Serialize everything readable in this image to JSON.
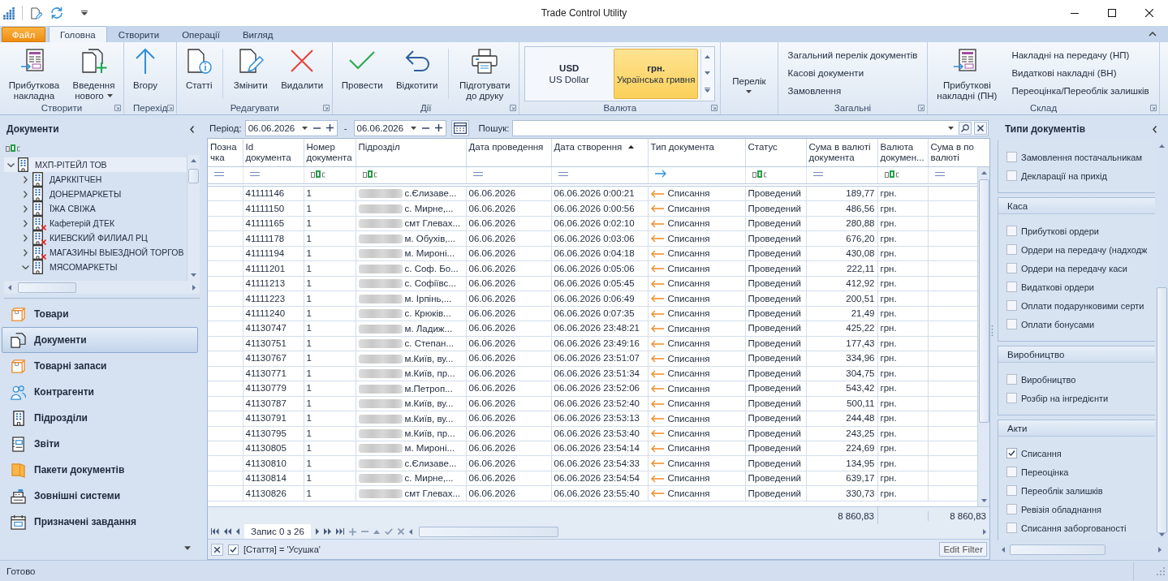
{
  "window": {
    "title": "Trade Control Utility"
  },
  "ribbon": {
    "file_tab": "Файл",
    "tabs": [
      {
        "label": "Головна",
        "selected": true
      },
      {
        "label": "Створити",
        "selected": false
      },
      {
        "label": "Операції",
        "selected": false
      },
      {
        "label": "Вигляд",
        "selected": false
      }
    ],
    "groups": [
      {
        "title": "Створити",
        "launcher": true,
        "items": [
          {
            "kind": "large",
            "label": "Прибуткова накладна",
            "dropdown": false
          },
          {
            "kind": "large",
            "label": "Введення нового",
            "dropdown": true
          }
        ]
      },
      {
        "title": "Перехід",
        "launcher": true,
        "items": [
          {
            "kind": "large",
            "label": "Вгору",
            "dropdown": false
          }
        ]
      },
      {
        "title": "Редагувати",
        "launcher": true,
        "items": [
          {
            "kind": "large",
            "label": "Статті",
            "dropdown": false
          },
          {
            "kind": "separator"
          },
          {
            "kind": "large",
            "label": "Змінити",
            "dropdown": false
          },
          {
            "kind": "large",
            "label": "Видалити",
            "dropdown": false
          }
        ]
      },
      {
        "title": "Дії",
        "launcher": true,
        "items": [
          {
            "kind": "large",
            "label": "Провести",
            "dropdown": false
          },
          {
            "kind": "large",
            "label": "Відкотити",
            "dropdown": false
          },
          {
            "kind": "separator"
          },
          {
            "kind": "large",
            "label": "Підготувати до друку",
            "dropdown": false
          }
        ]
      },
      {
        "title": "Валюта",
        "launcher": true,
        "items": [
          {
            "kind": "gallery",
            "options": [
              {
                "code": "USD",
                "name": "US Dollar",
                "selected": false
              },
              {
                "code": "грн.",
                "name": "Українська гривня",
                "selected": true
              }
            ]
          }
        ]
      },
      {
        "items": [
          {
            "kind": "dropdown",
            "label": "Перелік"
          }
        ]
      },
      {
        "title": "Загальні",
        "launcher": true,
        "items": [
          {
            "kind": "links",
            "entries": [
              "Загальний перелік документів",
              "Касові документи",
              "Замовлення"
            ]
          }
        ]
      },
      {
        "title": "Склад",
        "launcher": true,
        "items": [
          {
            "kind": "large",
            "label": "Прибуткові накладні (ПН)",
            "dropdown": false
          },
          {
            "kind": "links",
            "entries": [
              "Накладні на передачу (НП)",
              "Видаткові накладні (ВН)",
              "Переоцінка/Переоблік залишків"
            ]
          }
        ]
      }
    ]
  },
  "left_panel": {
    "title": "Документи",
    "tree": [
      {
        "label": "МХП-РІТЕЙЛ ТОВ",
        "expanded": true,
        "selected": true,
        "inactive": false,
        "children": [
          {
            "label": "ДАРККІТЧЕН",
            "expanded": false,
            "selected": false,
            "inactive": false
          },
          {
            "label": "ДОНЕРМАРКЕТЫ",
            "expanded": false,
            "selected": false,
            "inactive": false
          },
          {
            "label": "ЇЖА СВІЖА",
            "expanded": false,
            "selected": false,
            "inactive": false
          },
          {
            "label": "Кафетерій ДТЕК",
            "expanded": false,
            "selected": false,
            "inactive": true
          },
          {
            "label": "КИЕВСКИЙ ФИЛИАЛ РЦ",
            "expanded": false,
            "selected": false,
            "inactive": true
          },
          {
            "label": "МАГАЗИНЫ ВЫЕЗДНОЙ ТОРГОВ",
            "expanded": false,
            "selected": false,
            "inactive": true
          },
          {
            "label": "МЯСОМАРКЕТЫ",
            "expanded": true,
            "selected": false,
            "inactive": false
          }
        ]
      }
    ],
    "nav": [
      {
        "label": "Товари",
        "selected": false
      },
      {
        "label": "Документи",
        "selected": true
      },
      {
        "label": "Товарні запаси",
        "selected": false
      },
      {
        "label": "Контрагенти",
        "selected": false
      },
      {
        "label": "Підрозділи",
        "selected": false
      },
      {
        "label": "Звіти",
        "selected": false
      },
      {
        "label": "Пакети документів",
        "selected": false
      },
      {
        "label": "Зовнішні системи",
        "selected": false
      },
      {
        "label": "Призначені завдання",
        "selected": false
      }
    ]
  },
  "period": {
    "label": "Період:",
    "from": "06.06.2026",
    "separator": "-",
    "to": "06.06.2026"
  },
  "search": {
    "label": "Пошук:"
  },
  "table": {
    "columns": [
      {
        "label": "Позначка",
        "kind": "equals",
        "sorted": false
      },
      {
        "label": "Id документа",
        "kind": "equals",
        "sorted": false
      },
      {
        "label": "Номер документа",
        "kind": "text",
        "sorted": false
      },
      {
        "label": "Підрозділ",
        "kind": "text",
        "sorted": false
      },
      {
        "label": "Дата проведення",
        "kind": "equals",
        "sorted": false
      },
      {
        "label": "Дата створення",
        "kind": "equals",
        "sorted": true
      },
      {
        "label": "Тип документа",
        "kind": "arrow",
        "sorted": false
      },
      {
        "label": "Статус",
        "kind": "text",
        "sorted": false
      },
      {
        "label": "Сума в валюті документа",
        "kind": "equals",
        "sorted": false
      },
      {
        "label": "Валюта докумен...",
        "kind": "text",
        "sorted": false
      },
      {
        "label": "Сума в по валюті",
        "kind": "equals",
        "sorted": false
      }
    ],
    "rows": [
      {
        "id": "41111146",
        "number": "1",
        "subdivision": "с.Єлизаве...",
        "posted": "06.06.2026",
        "created": "06.06.2026 0:00:21",
        "type": "Списання",
        "status": "Проведений",
        "amount": "189,77",
        "currency": "грн."
      },
      {
        "id": "41111150",
        "number": "1",
        "subdivision": "с. Мирне,...",
        "posted": "06.06.2026",
        "created": "06.06.2026 0:00:56",
        "type": "Списання",
        "status": "Проведений",
        "amount": "486,56",
        "currency": "грн."
      },
      {
        "id": "41111165",
        "number": "1",
        "subdivision": "смт Глевах...",
        "posted": "06.06.2026",
        "created": "06.06.2026 0:02:10",
        "type": "Списання",
        "status": "Проведений",
        "amount": "280,88",
        "currency": "грн."
      },
      {
        "id": "41111178",
        "number": "1",
        "subdivision": "м. Обухів,...",
        "posted": "06.06.2026",
        "created": "06.06.2026 0:03:06",
        "type": "Списання",
        "status": "Проведений",
        "amount": "676,20",
        "currency": "грн."
      },
      {
        "id": "41111194",
        "number": "1",
        "subdivision": "м. Миронi...",
        "posted": "06.06.2026",
        "created": "06.06.2026 0:04:18",
        "type": "Списання",
        "status": "Проведений",
        "amount": "430,08",
        "currency": "грн."
      },
      {
        "id": "41111201",
        "number": "1",
        "subdivision": "с. Соф. Бо...",
        "posted": "06.06.2026",
        "created": "06.06.2026 0:05:06",
        "type": "Списання",
        "status": "Проведений",
        "amount": "222,11",
        "currency": "грн."
      },
      {
        "id": "41111213",
        "number": "1",
        "subdivision": "с. Софіївс...",
        "posted": "06.06.2026",
        "created": "06.06.2026 0:05:45",
        "type": "Списання",
        "status": "Проведений",
        "amount": "412,92",
        "currency": "грн."
      },
      {
        "id": "41111223",
        "number": "1",
        "subdivision": "м. Ірпінь,...",
        "posted": "06.06.2026",
        "created": "06.06.2026 0:06:49",
        "type": "Списання",
        "status": "Проведений",
        "amount": "200,51",
        "currency": "грн."
      },
      {
        "id": "41111240",
        "number": "1",
        "subdivision": "с. Крюків...",
        "posted": "06.06.2026",
        "created": "06.06.2026 0:07:35",
        "type": "Списання",
        "status": "Проведений",
        "amount": "21,49",
        "currency": "грн."
      },
      {
        "id": "41130747",
        "number": "1",
        "subdivision": "м. Ладиж...",
        "posted": "06.06.2026",
        "created": "06.06.2026 23:48:21",
        "type": "Списання",
        "status": "Проведений",
        "amount": "425,22",
        "currency": "грн."
      },
      {
        "id": "41130751",
        "number": "1",
        "subdivision": "с. Степан...",
        "posted": "06.06.2026",
        "created": "06.06.2026 23:49:16",
        "type": "Списання",
        "status": "Проведений",
        "amount": "177,43",
        "currency": "грн."
      },
      {
        "id": "41130767",
        "number": "1",
        "subdivision": "м.Київ, ву...",
        "posted": "06.06.2026",
        "created": "06.06.2026 23:51:07",
        "type": "Списання",
        "status": "Проведений",
        "amount": "334,96",
        "currency": "грн."
      },
      {
        "id": "41130771",
        "number": "1",
        "subdivision": "м.Київ, пр...",
        "posted": "06.06.2026",
        "created": "06.06.2026 23:51:34",
        "type": "Списання",
        "status": "Проведений",
        "amount": "304,75",
        "currency": "грн."
      },
      {
        "id": "41130779",
        "number": "1",
        "subdivision": "м.Петроп...",
        "posted": "06.06.2026",
        "created": "06.06.2026 23:52:06",
        "type": "Списання",
        "status": "Проведений",
        "amount": "543,42",
        "currency": "грн."
      },
      {
        "id": "41130787",
        "number": "1",
        "subdivision": "м.Київ, ву...",
        "posted": "06.06.2026",
        "created": "06.06.2026 23:52:40",
        "type": "Списання",
        "status": "Проведений",
        "amount": "500,11",
        "currency": "грн."
      },
      {
        "id": "41130791",
        "number": "1",
        "subdivision": "м.Київ, ву...",
        "posted": "06.06.2026",
        "created": "06.06.2026 23:53:13",
        "type": "Списання",
        "status": "Проведений",
        "amount": "244,48",
        "currency": "грн."
      },
      {
        "id": "41130795",
        "number": "1",
        "subdivision": "м.Київ, пр...",
        "posted": "06.06.2026",
        "created": "06.06.2026 23:53:40",
        "type": "Списання",
        "status": "Проведений",
        "amount": "243,25",
        "currency": "грн."
      },
      {
        "id": "41130805",
        "number": "1",
        "subdivision": "м. Миронi...",
        "posted": "06.06.2026",
        "created": "06.06.2026 23:54:14",
        "type": "Списання",
        "status": "Проведений",
        "amount": "224,69",
        "currency": "грн."
      },
      {
        "id": "41130810",
        "number": "1",
        "subdivision": "с.Єлизаве...",
        "posted": "06.06.2026",
        "created": "06.06.2026 23:54:33",
        "type": "Списання",
        "status": "Проведений",
        "amount": "134,95",
        "currency": "грн."
      },
      {
        "id": "41130814",
        "number": "1",
        "subdivision": "с. Мирне,...",
        "posted": "06.06.2026",
        "created": "06.06.2026 23:54:54",
        "type": "Списання",
        "status": "Проведений",
        "amount": "639,17",
        "currency": "грн."
      },
      {
        "id": "41130826",
        "number": "1",
        "subdivision": "смт Глевах...",
        "posted": "06.06.2026",
        "created": "06.06.2026 23:55:40",
        "type": "Списання",
        "status": "Проведений",
        "amount": "330,73",
        "currency": "грн."
      }
    ],
    "totals": {
      "amount": "8 860,83",
      "column_11": "8 860,83"
    }
  },
  "navigator": {
    "record": "Запис 0 з 26"
  },
  "filter_panel": {
    "enabled": true,
    "expression": "[Стаття] = 'Усушка'",
    "edit_button": "Edit Filter"
  },
  "right_panel": {
    "title": "Типи документів",
    "groups": [
      {
        "items": [
          {
            "label": "Замовлення постачальникам",
            "checked": false
          },
          {
            "label": "Декларації на прихід",
            "checked": false
          }
        ]
      },
      {
        "title": "Каса",
        "items": [
          {
            "label": "Прибуткові ордери",
            "checked": false
          },
          {
            "label": "Ордери на передачу (надходж",
            "checked": false
          },
          {
            "label": "Ордери на передачу каси",
            "checked": false
          },
          {
            "label": "Видаткові ордери",
            "checked": false
          },
          {
            "label": "Оплати подарунковими серти",
            "checked": false
          },
          {
            "label": "Оплати бонусами",
            "checked": false
          }
        ]
      },
      {
        "title": "Виробництво",
        "items": [
          {
            "label": "Виробництво",
            "checked": false
          },
          {
            "label": "Розбір на інгредієнти",
            "checked": false
          }
        ]
      },
      {
        "title": "Акти",
        "items": [
          {
            "label": "Списання",
            "checked": true
          },
          {
            "label": "Переоцінка",
            "checked": false
          },
          {
            "label": "Переоблік залишків",
            "checked": false
          },
          {
            "label": "Ревізія обладнання",
            "checked": false
          },
          {
            "label": "Списання заборгованості",
            "checked": false
          }
        ]
      }
    ]
  },
  "status_bar": {
    "text": "Готово"
  }
}
